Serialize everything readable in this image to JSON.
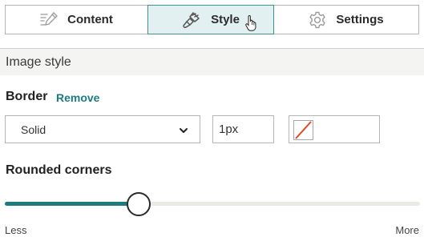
{
  "tabs": [
    {
      "label": "Content",
      "icon": "pencil-edit-icon",
      "active": false
    },
    {
      "label": "Style",
      "icon": "paint-brush-icon",
      "active": true
    },
    {
      "label": "Settings",
      "icon": "gear-icon",
      "active": false
    }
  ],
  "section": {
    "title": "Image style"
  },
  "border": {
    "title": "Border",
    "remove_label": "Remove",
    "style_value": "Solid",
    "width_value": "1px",
    "color": "none"
  },
  "corners": {
    "title": "Rounded corners",
    "min_label": "Less",
    "max_label": "More",
    "value": 0.32
  },
  "colors": {
    "accent": "#1f7a80",
    "active_tab_bg": "#e3f0f1",
    "no_color_slash": "#e0492a"
  }
}
